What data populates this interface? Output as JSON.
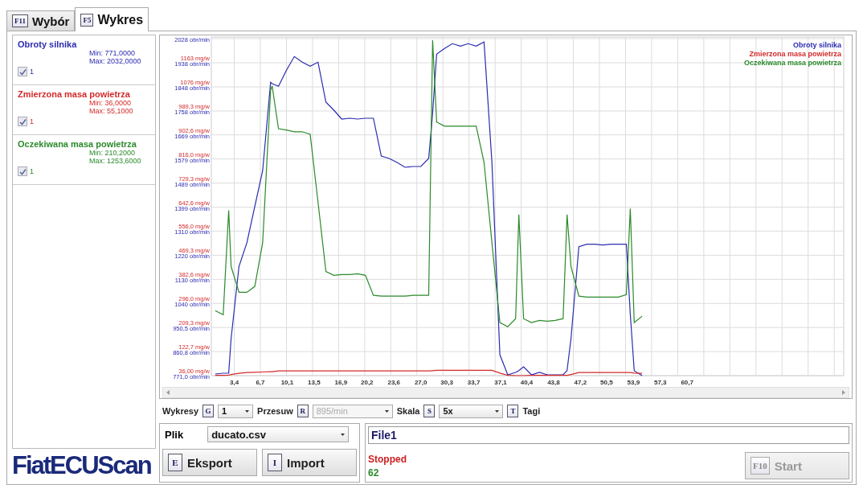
{
  "tabs": [
    {
      "key": "F11",
      "label": "Wybór",
      "selected": false
    },
    {
      "key": "F5",
      "label": "Wykres",
      "selected": true
    }
  ],
  "series_panel": [
    {
      "name": "Obroty silnika",
      "color": "#2b2bb0",
      "min": "Min: 771,0000",
      "max": "Max: 2032,0000",
      "checked": true,
      "check_label": "1"
    },
    {
      "name": "Zmierzona masa powietrza",
      "color": "#d42a2a",
      "min": "Min: 36,0000",
      "max": "Max: 55,1000",
      "checked": true,
      "check_label": "1"
    },
    {
      "name": "Oczekiwana masa powietrza",
      "color": "#2a8a2a",
      "min": "Min: 210,2000",
      "max": "Max: 1253,6000",
      "checked": true,
      "check_label": "1"
    }
  ],
  "logo": "FiatECUScan",
  "chart": {
    "chart_data": {
      "type": "line",
      "x": [
        1,
        2,
        2.7,
        3,
        4,
        5,
        6,
        7,
        8,
        8.2,
        9,
        10,
        11,
        12,
        13,
        14,
        15,
        16,
        17,
        18,
        19,
        20,
        21,
        22,
        23,
        24,
        25,
        26,
        27,
        28,
        28.5,
        29,
        30,
        31,
        32,
        33,
        34,
        35,
        36,
        37,
        38,
        39,
        39.4,
        40,
        41,
        42,
        43,
        44,
        45,
        45.5,
        46,
        47,
        48,
        49,
        50,
        51,
        52,
        53,
        53.5,
        54,
        55
      ],
      "series": [
        {
          "name": "Obroty silnika",
          "color": "#2b2bb0",
          "values": [
            777,
            780,
            780,
            909,
            1178,
            1267,
            1402,
            1536,
            1865,
            1860,
            1850,
            1910,
            1961,
            1940,
            1925,
            1940,
            1791,
            1761,
            1728,
            1731,
            1728,
            1731,
            1731,
            1590,
            1581,
            1566,
            1548,
            1551,
            1551,
            1581,
            1750,
            1970,
            1991,
            2009,
            2000,
            2009,
            2000,
            2015,
            1566,
            849,
            774,
            783,
            790,
            804,
            774,
            783,
            774,
            774,
            774,
            790,
            909,
            1252,
            1261,
            1261,
            1258,
            1261,
            1261,
            1261,
            1000,
            789,
            771
          ]
        },
        {
          "name": "Zmierzona masa powietrza",
          "color": "#d42a2a",
          "axis": "y2",
          "values": [
            37,
            37,
            38,
            40,
            44,
            47,
            48,
            49,
            50,
            50,
            53,
            53,
            53,
            53,
            53,
            53,
            53,
            53,
            53,
            53,
            53,
            53,
            53,
            53,
            53,
            53,
            53,
            53,
            53,
            53,
            54,
            55,
            55,
            55,
            55,
            55,
            55,
            55,
            55,
            45,
            37,
            36,
            36,
            36,
            37,
            37,
            37,
            37,
            37,
            37,
            40,
            47,
            47,
            47,
            47,
            47,
            47,
            47,
            47,
            45,
            44
          ]
        },
        {
          "name": "Oczekiwana masa powietrza",
          "color": "#2a8a2a",
          "axis": "y2",
          "values": [
            270,
            255,
            631,
            429,
            336,
            336,
            357,
            515,
            1064,
            1079,
            925,
            920,
            914,
            914,
            905,
            660,
            411,
            397,
            400,
            400,
            403,
            397,
            325,
            322,
            322,
            322,
            322,
            325,
            325,
            325,
            1243,
            949,
            934,
            934,
            934,
            934,
            934,
            804,
            515,
            227,
            212,
            241,
            616,
            241,
            227,
            235,
            232,
            235,
            241,
            616,
            429,
            322,
            319,
            319,
            319,
            319,
            319,
            328,
            637,
            227,
            250
          ]
        }
      ],
      "grid": true,
      "xlim": [
        0.5,
        80.5
      ],
      "ylim": [
        771,
        2034
      ],
      "y2lim": [
        36,
        1255
      ],
      "xticks": [
        {
          "value": 3.4,
          "label": "3,4"
        },
        {
          "value": 6.7,
          "label": "6,7"
        },
        {
          "value": 10.1,
          "label": "10,1"
        },
        {
          "value": 13.5,
          "label": "13,5"
        },
        {
          "value": 16.9,
          "label": "16,9"
        },
        {
          "value": 20.2,
          "label": "20,2"
        },
        {
          "value": 23.6,
          "label": "23,6"
        },
        {
          "value": 27.0,
          "label": "27,0"
        },
        {
          "value": 30.3,
          "label": "30,3"
        },
        {
          "value": 33.7,
          "label": "33,7"
        },
        {
          "value": 37.1,
          "label": "37,1"
        },
        {
          "value": 40.4,
          "label": "40,4"
        },
        {
          "value": 43.8,
          "label": "43,8"
        },
        {
          "value": 47.2,
          "label": "47,2"
        },
        {
          "value": 50.5,
          "label": "50,5"
        },
        {
          "value": 53.9,
          "label": "53,9"
        },
        {
          "value": 57.3,
          "label": "57,3"
        },
        {
          "value": 60.7,
          "label": "60,7"
        }
      ],
      "yticks": [
        {
          "value": 771,
          "label": "771,0 obr/min"
        },
        {
          "value": 860.8,
          "label": "860,8 obr/min"
        },
        {
          "value": 950.5,
          "label": "950,5 obr/min"
        },
        {
          "value": 1040,
          "label": "1040 obr/min"
        },
        {
          "value": 1130,
          "label": "1130 obr/min"
        },
        {
          "value": 1220,
          "label": "1220 obr/min"
        },
        {
          "value": 1310,
          "label": "1310 obr/min"
        },
        {
          "value": 1399,
          "label": "1399 obr/min"
        },
        {
          "value": 1489,
          "label": "1489 obr/min"
        },
        {
          "value": 1579,
          "label": "1579 obr/min"
        },
        {
          "value": 1669,
          "label": "1669 obr/min"
        },
        {
          "value": 1758,
          "label": "1758 obr/min"
        },
        {
          "value": 1848,
          "label": "1848 obr/min"
        },
        {
          "value": 1938,
          "label": "1938 obr/min"
        },
        {
          "value": 2028,
          "label": "2028 obr/min"
        }
      ],
      "y2ticks": [
        {
          "value": 36,
          "label": "36,00 mg/w"
        },
        {
          "value": 122.7,
          "label": "122,7 mg/w"
        },
        {
          "value": 209.3,
          "label": "209,3 mg/w"
        },
        {
          "value": 296,
          "label": "296,0 mg/w"
        },
        {
          "value": 382.6,
          "label": "382,6 mg/w"
        },
        {
          "value": 469.3,
          "label": "469,3 mg/w"
        },
        {
          "value": 556,
          "label": "556,0 mg/w"
        },
        {
          "value": 642.6,
          "label": "642,6 mg/w"
        },
        {
          "value": 729.3,
          "label": "729,3 mg/w"
        },
        {
          "value": 816,
          "label": "816,0 mg/w"
        },
        {
          "value": 902.6,
          "label": "902,6 mg/w"
        },
        {
          "value": 989.3,
          "label": "989,3 mg/w"
        },
        {
          "value": 1076,
          "label": "1076 mg/w"
        },
        {
          "value": 1163,
          "label": "1163 mg/w"
        }
      ]
    }
  },
  "toolbar": [
    {
      "kind": "label",
      "text": "Wykresy"
    },
    {
      "kind": "key",
      "text": "G"
    },
    {
      "kind": "select",
      "text": "1",
      "disabled": false
    },
    {
      "kind": "label",
      "text": "Przesuw"
    },
    {
      "kind": "key",
      "text": "R"
    },
    {
      "kind": "select",
      "text": "895/min",
      "disabled": true
    },
    {
      "kind": "label",
      "text": "Skala"
    },
    {
      "kind": "key",
      "text": "S"
    },
    {
      "kind": "select",
      "text": "5x",
      "disabled": false
    },
    {
      "kind": "key",
      "text": "T"
    },
    {
      "kind": "label",
      "text": "Tagi"
    }
  ],
  "file_panel": {
    "label": "Plik",
    "file": "ducato.csv",
    "buttons": [
      {
        "key": "E",
        "label": "Eksport"
      },
      {
        "key": "I",
        "label": "Import"
      }
    ]
  },
  "status_panel": {
    "name": "File1",
    "state": "Stopped",
    "count": "62",
    "start_button": {
      "key": "F10",
      "label": "Start",
      "disabled": true
    }
  }
}
